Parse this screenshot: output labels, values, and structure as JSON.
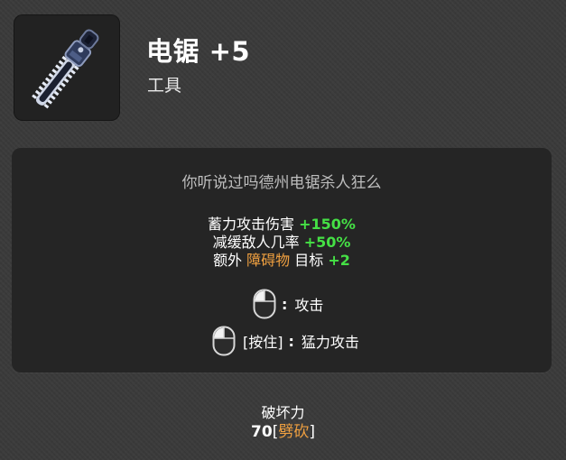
{
  "item": {
    "name": "电锯 +5",
    "type": "工具",
    "icon": "chainsaw-icon"
  },
  "description": {
    "flavor": "你听说过吗德州电锯杀人狂么",
    "stats": [
      {
        "label": "蓄力攻击伤害 ",
        "value": "+150%"
      },
      {
        "label": "减缓敌人几率 ",
        "value": "+50%"
      }
    ],
    "extra_target": {
      "prefix": "额外 ",
      "keyword": "障碍物",
      "middle": " 目标 ",
      "value": "+2"
    },
    "controls": {
      "primary": {
        "icon": "mouse-left-click-icon",
        "separator": ":",
        "action": "攻击"
      },
      "secondary": {
        "icon": "mouse-left-click-icon",
        "hold_label": "[按住]",
        "separator": ":",
        "action": "猛力攻击"
      }
    }
  },
  "damage": {
    "label": "破坏力",
    "value": "70",
    "type_prefix": "[",
    "type": "劈砍",
    "type_suffix": "]"
  },
  "colors": {
    "positive": "#45e045",
    "keyword": "#f0a040",
    "panel": "#252525",
    "background": "#3a3a3a"
  }
}
